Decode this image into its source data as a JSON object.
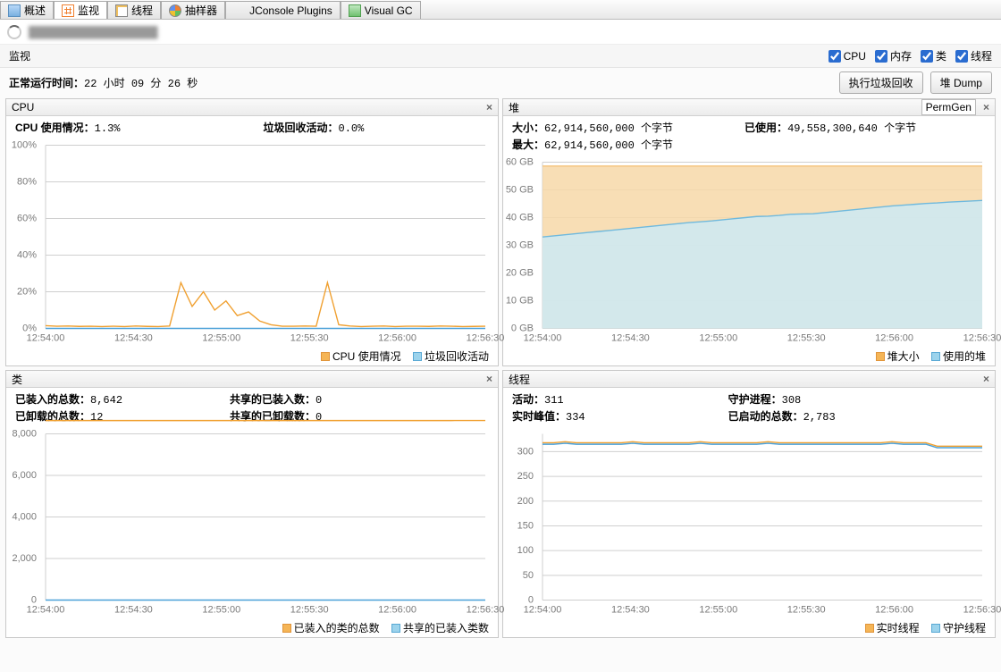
{
  "tabs": [
    {
      "id": "overview",
      "label": "概述"
    },
    {
      "id": "monitor",
      "label": "监视"
    },
    {
      "id": "threads",
      "label": "线程"
    },
    {
      "id": "sampler",
      "label": "抽样器"
    },
    {
      "id": "jconsole",
      "label": "JConsole Plugins"
    },
    {
      "id": "visualgc",
      "label": "Visual GC"
    }
  ],
  "active_tab": "monitor",
  "section_title": "监视",
  "checks": {
    "cpu": "CPU",
    "mem": "内存",
    "classes": "类",
    "threads": "线程"
  },
  "uptime_label": "正常运行时间：",
  "uptime_value": "22 小时 09 分 26 秒",
  "buttons": {
    "gc": "执行垃圾回收",
    "heapdump": "堆 Dump"
  },
  "panels": {
    "cpu": {
      "title": "CPU",
      "stats": {
        "cpu_usage_label": "CPU 使用情况：",
        "cpu_usage_value": "1.3%",
        "gc_activity_label": "垃圾回收活动：",
        "gc_activity_value": "0.0%"
      },
      "legend": {
        "a": "CPU 使用情况",
        "b": "垃圾回收活动"
      }
    },
    "heap": {
      "title": "堆",
      "selector": "PermGen",
      "stats": {
        "size_label": "大小：",
        "size_value": "62,914,560,000 个字节",
        "max_label": "最大：",
        "max_value": "62,914,560,000 个字节",
        "used_label": "已使用：",
        "used_value": "49,558,300,640 个字节"
      },
      "legend": {
        "a": "堆大小",
        "b": "使用的堆"
      }
    },
    "classes": {
      "title": "类",
      "stats": {
        "loaded_label": "已装入的总数：",
        "loaded_value": "8,642",
        "unloaded_label": "已卸载的总数：",
        "unloaded_value": "12",
        "shared_loaded_label": "共享的已装入数：",
        "shared_loaded_value": "0",
        "shared_unloaded_label": "共享的已卸载数：",
        "shared_unloaded_value": "0"
      },
      "legend": {
        "a": "已装入的类的总数",
        "b": "共享的已装入类数"
      }
    },
    "threads": {
      "title": "线程",
      "stats": {
        "live_label": "活动：",
        "live_value": "311",
        "peak_label": "实时峰值：",
        "peak_value": "334",
        "daemon_label": "守护进程：",
        "daemon_value": "308",
        "started_label": "已启动的总数：",
        "started_value": "2,783"
      },
      "legend": {
        "a": "实时线程",
        "b": "守护线程"
      }
    }
  },
  "time_ticks": [
    "12:54:00",
    "12:54:30",
    "12:55:00",
    "12:55:30",
    "12:56:00",
    "12:56:30"
  ],
  "chart_data": [
    {
      "id": "cpu",
      "type": "line",
      "x": [
        "12:54:00",
        "12:54:30",
        "12:55:00",
        "12:55:30",
        "12:56:00",
        "12:56:30"
      ],
      "ylim": [
        0,
        100
      ],
      "yticks": [
        0,
        20,
        40,
        60,
        80,
        100
      ],
      "ysuffix": "%",
      "series": [
        {
          "name": "CPU 使用情况",
          "color": "#f0a030",
          "values": [
            1.5,
            1.2,
            1.3,
            1.1,
            1.2,
            1.0,
            1.2,
            1.0,
            1.3,
            1.1,
            1.0,
            1.3,
            25,
            12,
            20,
            10,
            15,
            7,
            9,
            4,
            2,
            1.2,
            1.2,
            1.3,
            1.2,
            25,
            2,
            1.3,
            1.0,
            1.2,
            1.3,
            1.0,
            1.2,
            1.2,
            1.1,
            1.3,
            1.2,
            1.0,
            1.1,
            1.2
          ]
        },
        {
          "name": "垃圾回收活动",
          "color": "#4aa0d8",
          "values": [
            0,
            0,
            0,
            0,
            0,
            0,
            0,
            0,
            0,
            0,
            0,
            0,
            0,
            0,
            0,
            0,
            0,
            0,
            0,
            0,
            0,
            0,
            0,
            0,
            0,
            0,
            0,
            0,
            0,
            0,
            0,
            0,
            0,
            0,
            0,
            0,
            0,
            0,
            0,
            0
          ]
        }
      ]
    },
    {
      "id": "heap",
      "type": "area",
      "x": [
        "12:54:00",
        "12:54:30",
        "12:55:00",
        "12:55:30",
        "12:56:00",
        "12:56:30"
      ],
      "ylim": [
        0,
        60
      ],
      "yticks": [
        0,
        10,
        20,
        30,
        40,
        50,
        60
      ],
      "yunit": "GB",
      "series": [
        {
          "name": "堆大小",
          "color": "#f5c37a",
          "fill": "#f7d8a8",
          "values": [
            58.6,
            58.6,
            58.6,
            58.6,
            58.6,
            58.6,
            58.6,
            58.6,
            58.6,
            58.6,
            58.6,
            58.6,
            58.6,
            58.6,
            58.6,
            58.6,
            58.6,
            58.6,
            58.6,
            58.6,
            58.6,
            58.6,
            58.6,
            58.6,
            58.6,
            58.6,
            58.6,
            58.6,
            58.6,
            58.6,
            58.6,
            58.6,
            58.6,
            58.6,
            58.6,
            58.6,
            58.6,
            58.6,
            58.6,
            58.6
          ]
        },
        {
          "name": "使用的堆",
          "color": "#6fb9dd",
          "fill": "#cdeaf4",
          "values": [
            33,
            33.4,
            33.8,
            34.2,
            34.6,
            35.0,
            35.4,
            35.8,
            36.2,
            36.6,
            37.0,
            37.4,
            37.8,
            38.2,
            38.5,
            38.8,
            39.2,
            39.6,
            40.0,
            40.4,
            40.5,
            40.8,
            41.2,
            41.3,
            41.4,
            41.8,
            42.2,
            42.6,
            43.0,
            43.4,
            43.8,
            44.2,
            44.5,
            44.8,
            45.1,
            45.3,
            45.6,
            45.8,
            46.0,
            46.2
          ]
        }
      ]
    },
    {
      "id": "classes",
      "type": "line",
      "x": [
        "12:54:00",
        "12:54:30",
        "12:55:00",
        "12:55:30",
        "12:56:00",
        "12:56:30"
      ],
      "ylim": [
        0,
        8000
      ],
      "yticks": [
        0,
        2000,
        4000,
        6000,
        8000
      ],
      "series": [
        {
          "name": "已装入的类的总数",
          "color": "#f0a030",
          "values": [
            8640,
            8640,
            8640,
            8640,
            8640,
            8640,
            8640,
            8640,
            8640,
            8640,
            8640,
            8640,
            8640,
            8640,
            8640,
            8640,
            8640,
            8640,
            8640,
            8640,
            8640,
            8640,
            8640,
            8640,
            8640,
            8640,
            8640,
            8640,
            8640,
            8640,
            8640,
            8640,
            8640,
            8640,
            8640,
            8640,
            8640,
            8642,
            8642,
            8642
          ]
        },
        {
          "name": "共享的已装入类数",
          "color": "#4aa0d8",
          "values": [
            0,
            0,
            0,
            0,
            0,
            0,
            0,
            0,
            0,
            0,
            0,
            0,
            0,
            0,
            0,
            0,
            0,
            0,
            0,
            0,
            0,
            0,
            0,
            0,
            0,
            0,
            0,
            0,
            0,
            0,
            0,
            0,
            0,
            0,
            0,
            0,
            0,
            0,
            0,
            0
          ]
        }
      ]
    },
    {
      "id": "threads",
      "type": "line",
      "x": [
        "12:54:00",
        "12:54:30",
        "12:55:00",
        "12:55:30",
        "12:56:00",
        "12:56:30"
      ],
      "ylim": [
        0,
        300
      ],
      "yticks": [
        0,
        50,
        100,
        150,
        200,
        250,
        300
      ],
      "series": [
        {
          "name": "实时线程",
          "color": "#f0a030",
          "values": [
            318,
            318,
            320,
            318,
            318,
            318,
            318,
            318,
            320,
            318,
            318,
            318,
            318,
            318,
            320,
            318,
            318,
            318,
            318,
            318,
            320,
            318,
            318,
            318,
            318,
            318,
            318,
            318,
            318,
            318,
            318,
            320,
            318,
            318,
            318,
            311,
            311,
            311,
            311,
            311
          ]
        },
        {
          "name": "守护线程",
          "color": "#4aa0d8",
          "values": [
            315,
            315,
            317,
            315,
            315,
            315,
            315,
            315,
            317,
            315,
            315,
            315,
            315,
            315,
            317,
            315,
            315,
            315,
            315,
            315,
            317,
            315,
            315,
            315,
            315,
            315,
            315,
            315,
            315,
            315,
            315,
            317,
            315,
            315,
            315,
            308,
            308,
            308,
            308,
            308
          ]
        }
      ]
    }
  ]
}
